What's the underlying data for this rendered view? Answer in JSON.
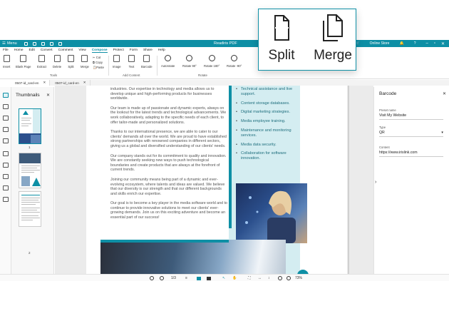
{
  "app": {
    "title": "Readiris PDF",
    "menu_label": "Menu",
    "online_store": "Online Store"
  },
  "menubar": [
    "File",
    "Home",
    "Edit",
    "Convert",
    "Comment",
    "View",
    "Compose",
    "Protect",
    "Form",
    "Share",
    "Help"
  ],
  "menubar_active": "Compose",
  "ribbon": {
    "tools": {
      "insert": "Insert",
      "blank_page": "Blank Page",
      "extract": "Extract",
      "delete": "Delete",
      "split": "Split",
      "merge": "Merge",
      "cut": "Cut",
      "copy": "Copy",
      "paste": "Paste",
      "group_label": "Tools"
    },
    "add_content": {
      "image": "Image",
      "text": "Text",
      "barcode": "Barcode",
      "group_label": "Add Content"
    },
    "rotate": {
      "autorotate": "Autorotate",
      "rotate_90": "Rotate 90°",
      "rotate_180": "Rotate 180°",
      "rotate_neg90": "Rotate -90°",
      "group_label": "Rotate"
    }
  },
  "tabs": [
    {
      "label": "0507-id_card-en"
    },
    {
      "label": "0507-id_card-en"
    }
  ],
  "thumbnails": {
    "title": "Thumbnails",
    "pages": [
      "1",
      "2"
    ]
  },
  "document": {
    "paragraphs": [
      "industries. Our expertise in technology and media allows us to develop unique and high-performing products for businesses worldwide.",
      "Our team is made up of passionate and dynamic experts, always on the lookout for the latest trends and technological advancements. We work collaboratively, adapting to the specific needs of each client, to offer tailor-made and personalized solutions.",
      "Thanks to our international presence, we are able to cater to our clients' demands all over the world. We are proud to have established strong partnerships with renowned companies in different sectors, giving us a global and diversified understanding of our clients' needs.",
      "Our company stands out for its commitment to quality and innovation. We are constantly seeking new ways to push technological boundaries and create products that are always at the forefront of current trends.",
      "Joining our community means being part of a dynamic and ever-evolving ecosystem, where talents and ideas are valued. We believe that our diversity is our strength and that our different backgrounds and skills enrich our expertise.",
      "Our goal is to become a key player in the media software world and to continue to provide innovative solutions to meet our clients' ever-growing demands. Join us on this exciting adventure and become an essential part of our success!"
    ],
    "bullets": [
      "Technical assistance and live support.",
      "Content storage databases.",
      "Digital marketing strategies.",
      "Media employee training.",
      "Maintenance and monitoring services.",
      "Media data security.",
      "Collaboration for software innovation."
    ]
  },
  "barcode_panel": {
    "title": "Barcode",
    "preset_label": "Preset name",
    "preset_value": "Visit My Website",
    "type_label": "Type",
    "type_value": "QR",
    "content_label": "Content",
    "content_value": "https://www.irislink.com"
  },
  "statusbar": {
    "page_indicator": "1/3",
    "zoom": "73%"
  },
  "callout": {
    "split_label": "Split",
    "merge_label": "Merge"
  },
  "colors": {
    "accent": "#0e8fa5",
    "panel_teal_light": "#d4edf1"
  }
}
